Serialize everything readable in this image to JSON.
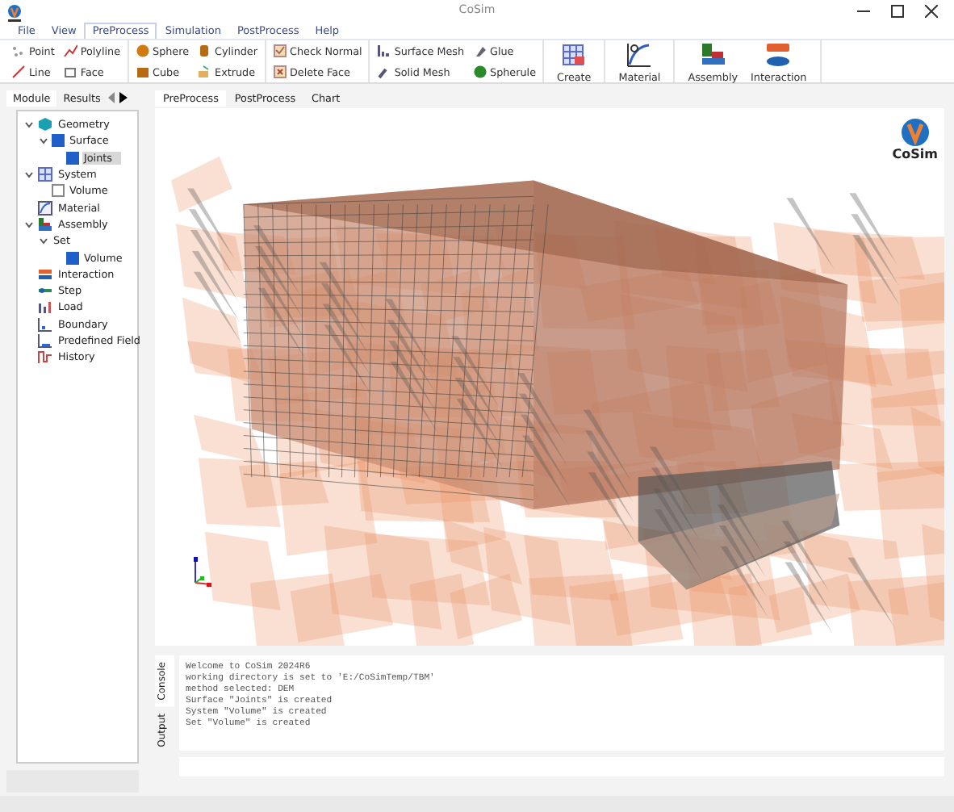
{
  "window": {
    "title": "CoSim"
  },
  "menu": [
    {
      "label": "File",
      "selected": false
    },
    {
      "label": "View",
      "selected": false
    },
    {
      "label": "PreProcess",
      "selected": true
    },
    {
      "label": "Simulation",
      "selected": false
    },
    {
      "label": "PostProcess",
      "selected": false
    },
    {
      "label": "Help",
      "selected": false
    }
  ],
  "ribbon": {
    "groups": [
      {
        "kind": "small",
        "items": [
          "Point",
          "Polyline",
          "Line",
          "Face"
        ]
      },
      {
        "kind": "small",
        "items": [
          "Sphere",
          "Cylinder",
          "Cube",
          "Extrude"
        ]
      },
      {
        "kind": "small",
        "items": [
          "Check Normal",
          "Delete Face"
        ]
      },
      {
        "kind": "small",
        "items": [
          "Surface Mesh",
          "Glue",
          "Solid Mesh",
          "Spherule"
        ]
      },
      {
        "kind": "large",
        "items": [
          "Create"
        ]
      },
      {
        "kind": "large",
        "items": [
          "Material"
        ]
      },
      {
        "kind": "large",
        "items": [
          "Assembly",
          "Interaction"
        ]
      }
    ]
  },
  "sidebar": {
    "tabs": [
      {
        "label": "Module",
        "selected": true
      },
      {
        "label": "Results",
        "selected": false
      }
    ],
    "tree": [
      {
        "label": "Geometry",
        "expanded": true,
        "children": [
          {
            "label": "Surface",
            "checked": true,
            "expanded": true,
            "children": [
              {
                "label": "Joints",
                "checked": true,
                "selected": true
              }
            ]
          }
        ]
      },
      {
        "label": "System",
        "expanded": true,
        "children": [
          {
            "label": "Volume",
            "checked": false
          }
        ]
      },
      {
        "label": "Material"
      },
      {
        "label": "Assembly",
        "expanded": true,
        "children": [
          {
            "label": "Set",
            "expanded": true,
            "children": [
              {
                "label": "Volume",
                "checked": true
              }
            ]
          }
        ]
      },
      {
        "label": "Interaction"
      },
      {
        "label": "Step"
      },
      {
        "label": "Load"
      },
      {
        "label": "Boundary"
      },
      {
        "label": "Predefined Field"
      },
      {
        "label": "History"
      }
    ]
  },
  "view_tabs": [
    {
      "label": "PreProcess",
      "selected": true
    },
    {
      "label": "PostProcess",
      "selected": false
    },
    {
      "label": "Chart",
      "selected": false
    }
  ],
  "viewport": {
    "logo_text": "CoSim"
  },
  "console": {
    "tabs": [
      {
        "label": "Console",
        "selected": true
      },
      {
        "label": "Output",
        "selected": false
      }
    ],
    "lines": [
      "Welcome to CoSim 2024R6",
      "working directory is set to 'E:/CoSimTemp/TBM'",
      "method selected: DEM",
      "Surface \"Joints\" is created",
      "System \"Volume\" is created",
      "Set \"Volume\" is created"
    ]
  }
}
